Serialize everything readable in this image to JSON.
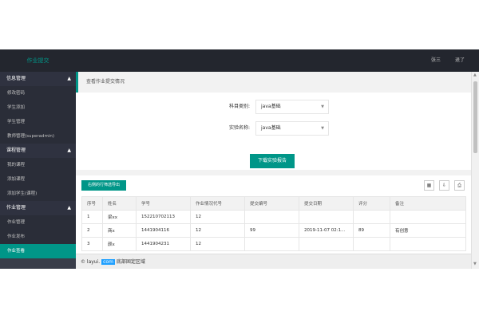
{
  "header": {
    "app_title": "作业提交",
    "user_name": "张三",
    "logout": "退了"
  },
  "sidebar": {
    "groups": [
      {
        "label": "信息管理",
        "items": [
          "修改密码",
          "学生添加",
          "学生管理",
          "教师管理(superadmin)"
        ]
      },
      {
        "label": "课程管理",
        "items": [
          "我的课程",
          "添加课程",
          "添加学生(课程)"
        ]
      },
      {
        "label": "作业管理",
        "items": [
          "作业管理",
          "作业发布",
          "作业查看"
        ]
      }
    ]
  },
  "panel": {
    "title": "查看作业提交情况",
    "course_label": "科目类别:",
    "course_value": "java基础",
    "experiment_label": "实验名称:",
    "experiment_value": "java基础",
    "download_button": "下载实验报告"
  },
  "table_tool": {
    "export_button": "右侧的行筛选导出",
    "icons": [
      "columns-icon",
      "export-icon",
      "print-icon"
    ]
  },
  "table": {
    "headers": [
      "序号",
      "姓名",
      "学号",
      "作业情况代号",
      "提交编号",
      "提交日期",
      "评分",
      "备注"
    ],
    "rows": [
      [
        "1",
        "梁xx",
        "152210702113",
        "12",
        "",
        "",
        "",
        ""
      ],
      [
        "2",
        "商x",
        "1441904116",
        "12",
        "99",
        "2019-11-07 02:1...",
        "89",
        "有创意"
      ],
      [
        "3",
        "颜x",
        "1441904231",
        "12",
        "",
        "",
        "",
        ""
      ]
    ]
  },
  "footer": {
    "copyright": "© layui.",
    "highlight": "com",
    "text": "底部固定区域"
  }
}
